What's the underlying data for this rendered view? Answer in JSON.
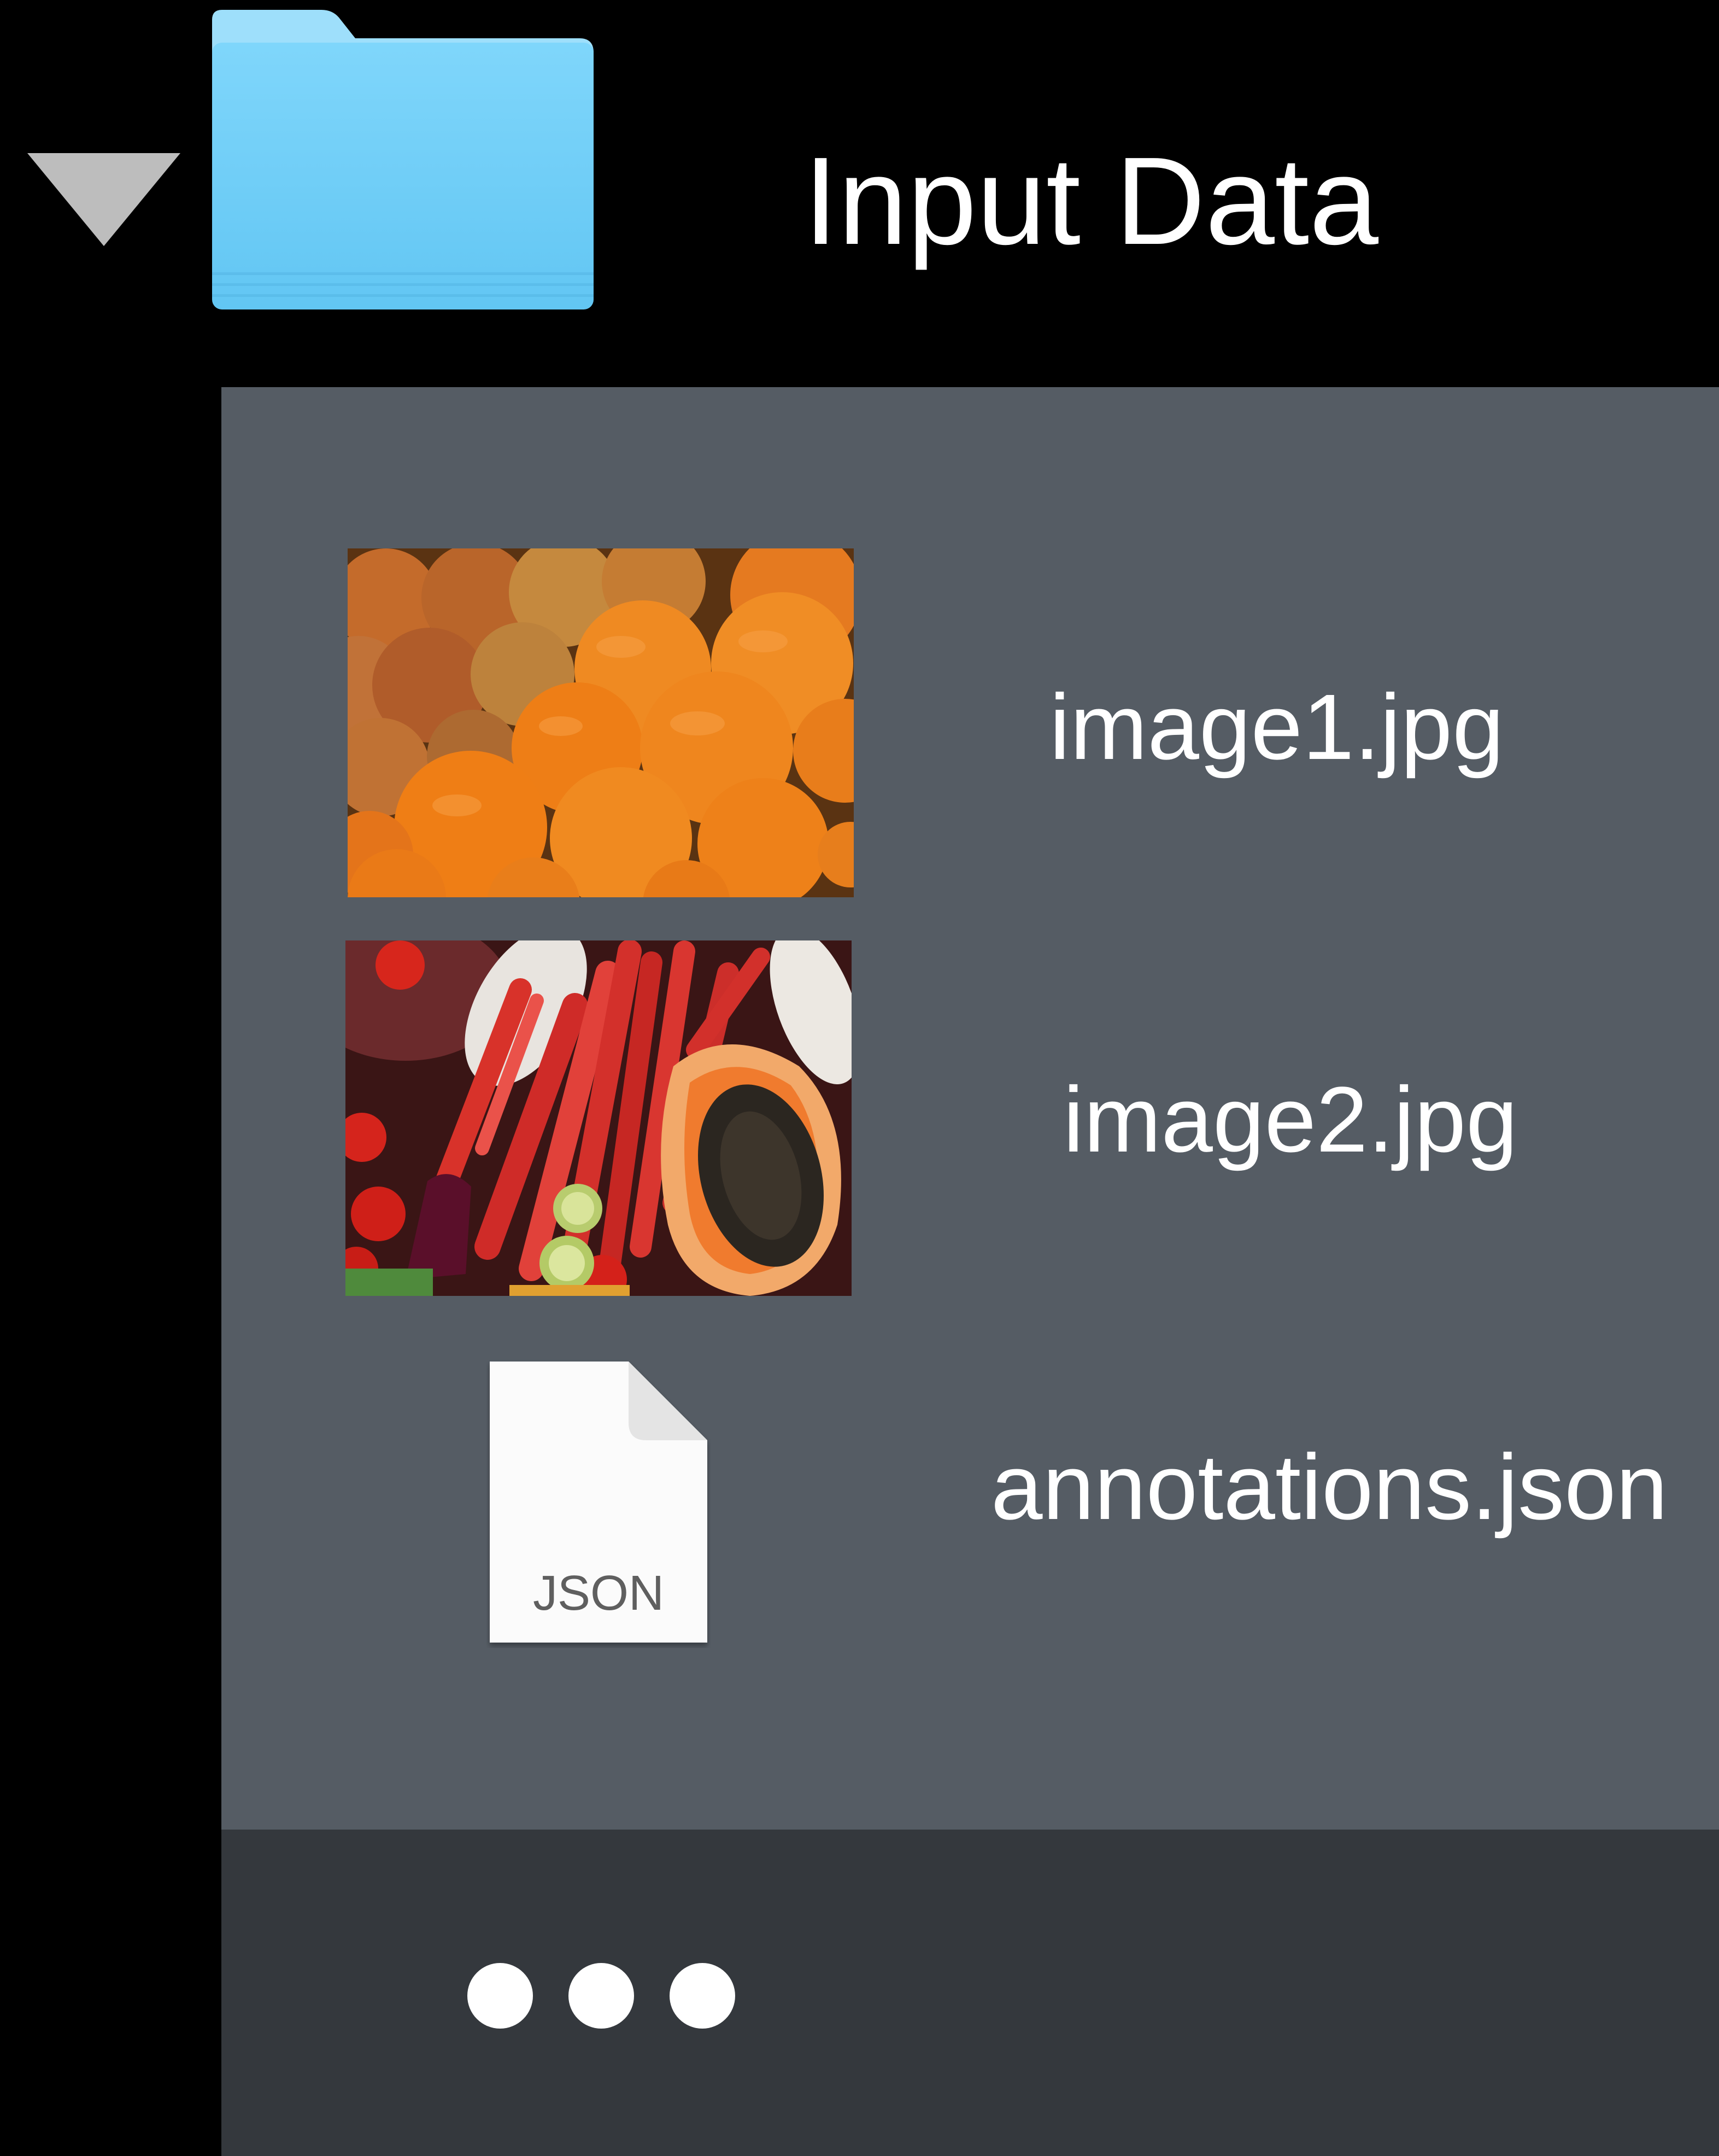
{
  "folder": {
    "title": "Input Data",
    "folder_icon": "folder-icon",
    "disclosure_icon": "disclosure-triangle-down-icon",
    "color": "#6ccdf7"
  },
  "files": [
    {
      "name": "image1.jpg",
      "icon": "image-thumbnail"
    },
    {
      "name": "image2.jpg",
      "icon": "image-thumbnail"
    },
    {
      "name": "annotations.json",
      "icon": "json-file-icon",
      "icon_label": "JSON"
    }
  ],
  "more_icon": "ellipsis-icon",
  "colors": {
    "background": "#000000",
    "panel": "#555c64",
    "footer": "#34383d",
    "text": "#ffffff"
  }
}
